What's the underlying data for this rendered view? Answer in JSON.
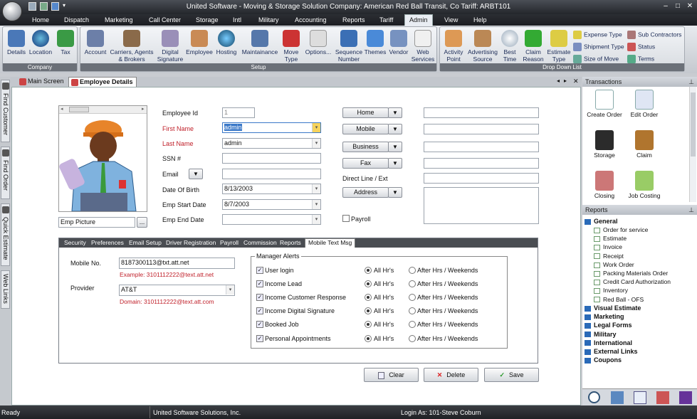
{
  "window": {
    "title": "United Software - Moving & Storage Solution   Company: American Red Ball Transit, Co  Tariff: ARBT101"
  },
  "menu": [
    "Home",
    "Dispatch",
    "Marketing",
    "Call Center",
    "Storage",
    "Intl",
    "Military",
    "Accounting",
    "Reports",
    "Tariff",
    "Admin",
    "View",
    "Help"
  ],
  "ribbon": {
    "company": {
      "label": "Company",
      "buttons": [
        "Details",
        "Location",
        "Tax"
      ]
    },
    "setup": {
      "label": "Setup",
      "buttons": [
        "Account",
        "Carriers, Agents\n& Brokers",
        "Digital\nSignature",
        "Employee",
        "Hosting",
        "Maintainance",
        "Move\nType",
        "Options...",
        "Sequence\nNumber",
        "Themes",
        "Vendor",
        "Web\nServices"
      ]
    },
    "dropdown": {
      "label": "Drop Down List",
      "buttons": [
        "Activity\nPoint",
        "Advertising\nSource",
        "Best\nTime",
        "Claim\nReason",
        "Estimate\nType"
      ],
      "small": [
        "Expense Type",
        "Shipment Type",
        "Size of Move",
        "Sub Contractors",
        "Status",
        "Terms"
      ]
    }
  },
  "doc_tabs": [
    "Main Screen",
    "Employee Details"
  ],
  "left_tabs": [
    "Find Customer",
    "Find Order",
    "Quick Estimate",
    "Web Links"
  ],
  "form": {
    "emp_picture": "Emp Picture",
    "employee_id_label": "Employee Id",
    "employee_id": "1",
    "first_name_label": "First Name",
    "first_name": "admin",
    "last_name_label": "Last Name",
    "last_name": "admin",
    "ssn_label": "SSN #",
    "email_label": "Email",
    "dob_label": "Date Of Birth",
    "dob": "8/13/2003",
    "start_label": "Emp Start Date",
    "start": "8/7/2003",
    "end_label": "Emp End Date",
    "phones": [
      "Home",
      "Mobile",
      "Business",
      "Fax"
    ],
    "direct_line": "Direct Line / Ext",
    "address": "Address",
    "payroll": "Payroll"
  },
  "subtabs": [
    "Security",
    "Preferences",
    "Email Setup",
    "Driver Registration",
    "Payroll",
    "Commission",
    "Reports",
    "Mobile Text Msg"
  ],
  "mobile": {
    "mobile_label": "Mobile No.",
    "mobile_value": "8187300113@txt.att.net",
    "mobile_example": "Example: 3101112222@text.att.net",
    "provider_label": "Provider",
    "provider_value": "AT&T",
    "provider_domain": "Domain: 3101112222@text.att.com",
    "alerts_title": "Manager Alerts",
    "alerts": [
      "User login",
      "Income Lead",
      "Income Customer Response",
      "Income Digital Signature",
      "Booked Job",
      "Personal Appointments"
    ],
    "opt_all": "All Hr's",
    "opt_after": "After Hrs / Weekends"
  },
  "actions": [
    "Clear",
    "Delete",
    "Save"
  ],
  "transactions": {
    "title": "Transactions",
    "items": [
      "Create Order",
      "Edit Order",
      "Storage",
      "Claim",
      "Closing",
      "Job Costing"
    ]
  },
  "reports": {
    "title": "Reports",
    "general": "General",
    "items": [
      "Order for service",
      "Estimate",
      "Invoice",
      "Receipt",
      "Work Order",
      "Packing Materials Order",
      "Credit Card Authorization",
      "Inventory",
      "Red Ball - OFS"
    ],
    "groups": [
      "Visual Estimate",
      "Marketing",
      "Legal Forms",
      "Military",
      "International",
      "External Links",
      "Coupons"
    ]
  },
  "status": {
    "left": "Ready",
    "company": "United Software Solutions, Inc.",
    "login": "Login As: 101-Steve Coburn"
  }
}
